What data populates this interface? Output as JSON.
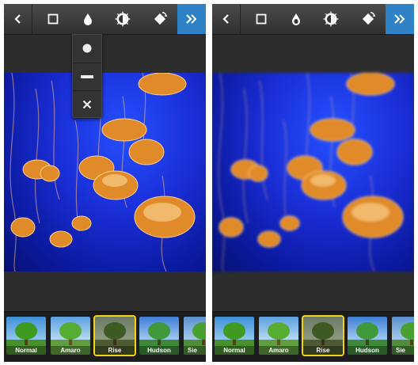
{
  "screens": [
    {
      "id": "left",
      "blur_menu_open": true,
      "filters": [
        {
          "label": "Normal"
        },
        {
          "label": "Amaro"
        },
        {
          "label": "Rise",
          "selected": true
        },
        {
          "label": "Hudson"
        },
        {
          "label": "Sie"
        }
      ]
    },
    {
      "id": "right",
      "blur_menu_open": false,
      "filters": [
        {
          "label": "Normal"
        },
        {
          "label": "Amaro"
        },
        {
          "label": "Rise",
          "selected": true
        },
        {
          "label": "Hudson"
        },
        {
          "label": "Sie"
        }
      ]
    }
  ],
  "toolbar_icons": [
    "back-chevron-icon",
    "frame-icon",
    "blur-drop-icon",
    "lux-sun-icon",
    "rotate-icon",
    "next-double-chevron-icon"
  ],
  "blur_menu_icons": [
    "radial-blur-icon",
    "linear-blur-icon",
    "close-blur-icon"
  ],
  "colors": {
    "next_button": "#2f82c5",
    "selected_filter_border": "#f4d40c",
    "toolbar": "#3a3a3a",
    "photo_water": "#1a2fd8"
  }
}
